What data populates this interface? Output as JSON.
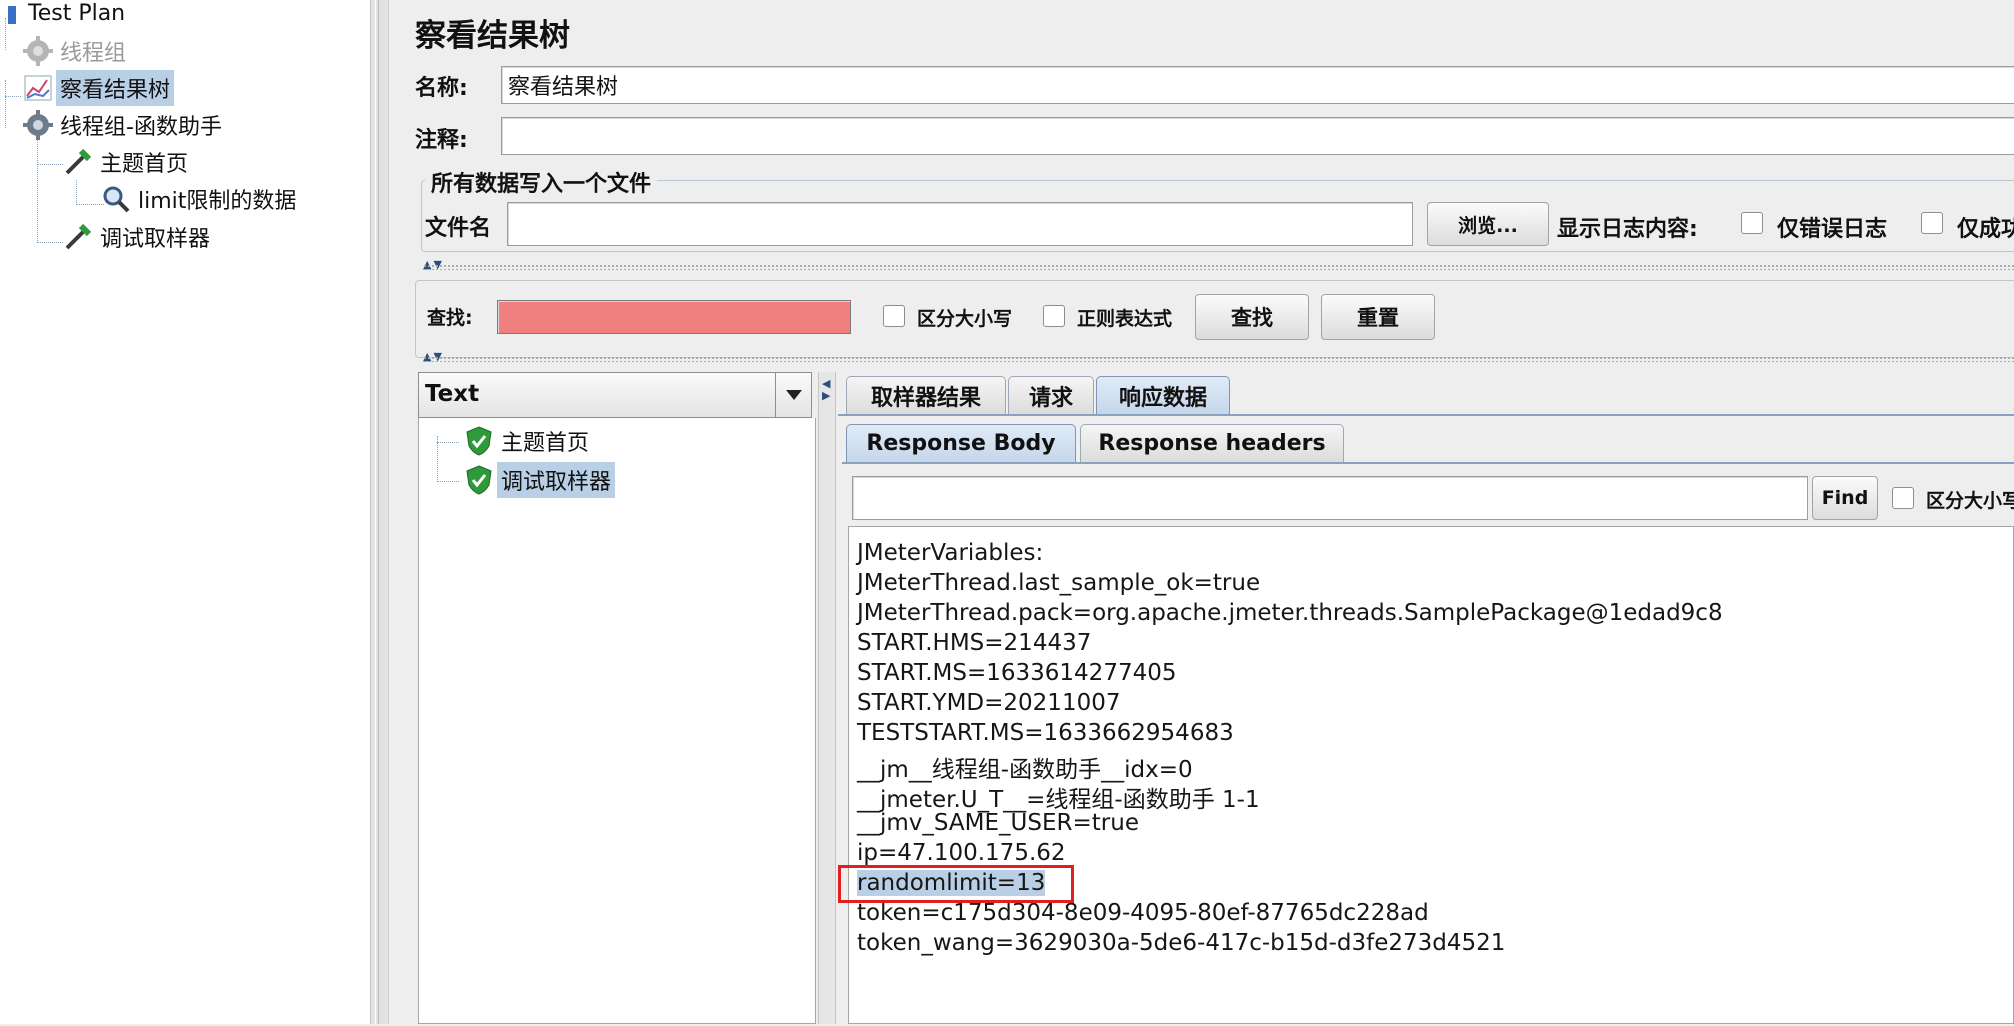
{
  "tree": {
    "test_plan": "Test Plan",
    "thread_group_1": "线程组",
    "view_results_tree": "察看结果树",
    "thread_group_2": "线程组-函数助手",
    "sampler_home": "主题首页",
    "extractor": "limit限制的数据",
    "debug_sampler": "调试取样器"
  },
  "panel": {
    "title": "察看结果树",
    "name_label": "名称:",
    "name_value": "察看结果树",
    "comment_label": "注释:",
    "comment_value": "",
    "file_group_title": "所有数据写入一个文件",
    "filename_label": "文件名",
    "filename_value": "",
    "browse_button": "浏览...",
    "log_content_label": "显示日志内容:",
    "errors_only_label": "仅错误日志",
    "success_only_label": "仅成功"
  },
  "search": {
    "label": "查找:",
    "value": "",
    "case_sensitive_label": "区分大小写",
    "regex_label": "正则表达式",
    "find_button": "查找",
    "reset_button": "重置"
  },
  "renderer": {
    "selected": "Text"
  },
  "results": [
    {
      "label": "主题首页",
      "status": "success"
    },
    {
      "label": "调试取样器",
      "status": "success"
    }
  ],
  "tabs": {
    "main": [
      "取样器结果",
      "请求",
      "响应数据"
    ],
    "main_active": "响应数据",
    "sub": [
      "Response Body",
      "Response headers"
    ],
    "sub_active": "Response Body"
  },
  "response_search": {
    "value": "",
    "find_button": "Find",
    "case_sensitive_label": "区分大小写"
  },
  "response_body": [
    "JMeterVariables:",
    "JMeterThread.last_sample_ok=true",
    "JMeterThread.pack=org.apache.jmeter.threads.SamplePackage@1edad9c8",
    "START.HMS=214437",
    "START.MS=1633614277405",
    "START.YMD=20211007",
    "TESTSTART.MS=1633662954683",
    "__jm__线程组-函数助手__idx=0",
    "__jmeter.U_T__=线程组-函数助手 1-1",
    "__jmv_SAME_USER=true",
    "ip=47.100.175.62",
    "randomlimit=13",
    "token=c175d304-8e09-4095-80ef-87765dc228ad",
    "token_wang=3629030a-5de6-417c-b15d-d3fe273d4521"
  ],
  "colors": {
    "selection": "#b8cfe5",
    "search_field_error": "#f08080",
    "highlight_box": "#e02020",
    "success_icon": "#2e9a3a"
  }
}
